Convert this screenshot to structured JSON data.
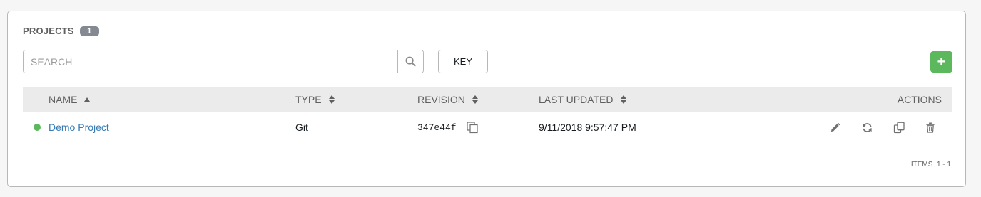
{
  "panel": {
    "title": "PROJECTS",
    "count": "1"
  },
  "search": {
    "placeholder": "SEARCH"
  },
  "toolbar": {
    "key_label": "KEY",
    "add_label": "+"
  },
  "table": {
    "columns": {
      "name": "NAME",
      "type": "TYPE",
      "revision": "REVISION",
      "last_updated": "LAST UPDATED",
      "actions": "ACTIONS"
    },
    "rows": [
      {
        "status": "success",
        "status_color": "#5cb85c",
        "name": "Demo Project",
        "type": "Git",
        "revision": "347e44f",
        "last_updated": "9/11/2018 9:57:47 PM",
        "actions": [
          "edit-icon",
          "sync-icon",
          "copy-icon",
          "delete-icon"
        ]
      }
    ]
  },
  "pagination": {
    "items_label": "ITEMS",
    "range": "1 - 1"
  },
  "colors": {
    "accent_green": "#5cb85c",
    "link_blue": "#337ab7",
    "header_bg": "#ebebeb"
  }
}
